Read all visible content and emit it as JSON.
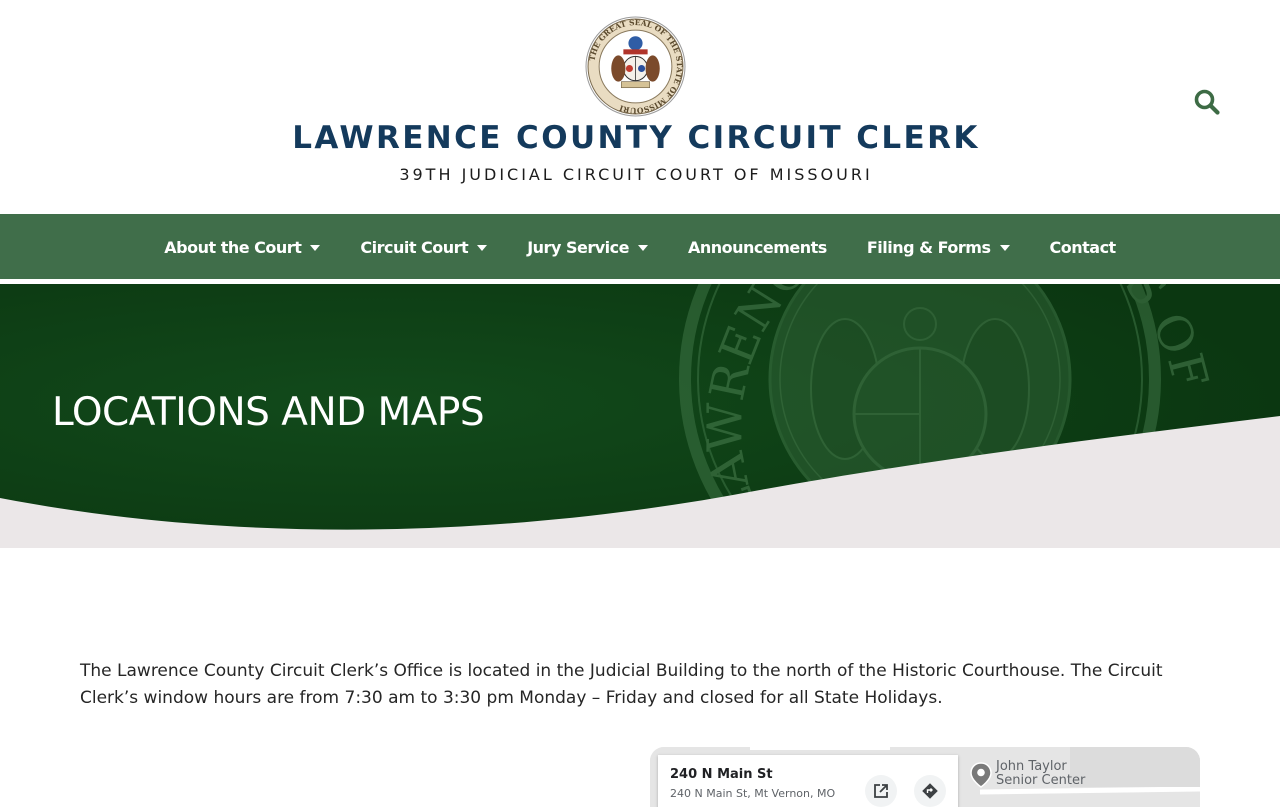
{
  "header": {
    "seal_text": "THE GREAT SEAL OF THE STATE OF MISSOURI",
    "site_title": "LAWRENCE COUNTY CIRCUIT CLERK",
    "site_subtitle": "39TH JUDICIAL CIRCUIT COURT OF MISSOURI",
    "search_icon": "search-icon"
  },
  "nav": {
    "items": [
      {
        "label": "About the Court",
        "has_dropdown": true
      },
      {
        "label": "Circuit Court",
        "has_dropdown": true
      },
      {
        "label": "Jury Service",
        "has_dropdown": true
      },
      {
        "label": "Announcements",
        "has_dropdown": false
      },
      {
        "label": "Filing & Forms",
        "has_dropdown": true
      },
      {
        "label": "Contact",
        "has_dropdown": false
      }
    ]
  },
  "hero": {
    "title": "LOCATIONS AND MAPS",
    "watermark_text_left": "LAWRENCE CO",
    "watermark_text_right": "ERK'S OF"
  },
  "content": {
    "intro": "The Lawrence County Circuit Clerk’s Office is located in the Judicial Building to the north of the Historic Courthouse. The Circuit Clerk’s window hours are from 7:30 am to 3:30 pm Monday – Friday and closed for all State Holidays."
  },
  "map": {
    "place_name": "240 N Main St",
    "address": "240 N Main St, Mt Vernon, MO",
    "poi_line1": "John Taylor",
    "poi_line2": "Senior Center",
    "open_icon": "open-in-new-icon",
    "directions_icon": "directions-icon"
  },
  "colors": {
    "title_blue": "#143a5c",
    "nav_green": "#406e4a",
    "hero_green": "#0d3f14",
    "accent_green": "#3d6b45",
    "wave_gray": "#ebe7e8"
  }
}
